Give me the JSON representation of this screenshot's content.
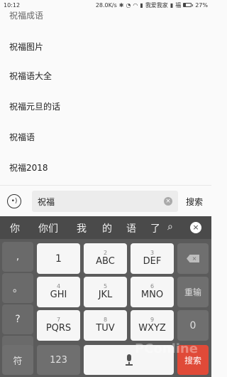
{
  "status_bar": {
    "time": "10:12",
    "network_speed": "28.0K/s",
    "carrier1": "我爱我家",
    "carrier2": "福",
    "battery": "27%",
    "icons": [
      "bluetooth-icon",
      "alarm-icon",
      "wifi-icon",
      "signal-icon"
    ]
  },
  "suggestions": [
    "祝福成语",
    "祝福图片",
    "祝福语大全",
    "祝福元旦的话",
    "祝福语",
    "祝福2018"
  ],
  "search": {
    "value": "祝福",
    "button_label": "搜索",
    "voice_icon": "voice-input-icon",
    "clear_icon": "clear-icon"
  },
  "keyboard": {
    "candidates": [
      "你",
      "你们",
      "我",
      "的",
      "语",
      "了"
    ],
    "side_keys": [
      ",",
      "。",
      "?",
      "!"
    ],
    "rows": [
      [
        {
          "digit": "",
          "letters": "1"
        },
        {
          "digit": "2",
          "letters": "ABC"
        },
        {
          "digit": "3",
          "letters": "DEF"
        }
      ],
      [
        {
          "digit": "4",
          "letters": "GHI"
        },
        {
          "digit": "5",
          "letters": "JKL"
        },
        {
          "digit": "6",
          "letters": "MNO"
        }
      ],
      [
        {
          "digit": "7",
          "letters": "PQRS"
        },
        {
          "digit": "8",
          "letters": "TUV"
        },
        {
          "digit": "9",
          "letters": "WXYZ"
        }
      ]
    ],
    "reenter_label": "重输",
    "zero_label": "0",
    "symbol_label": "符",
    "number_label": "123",
    "search_key_label": "搜索"
  },
  "watermark": "PConline"
}
